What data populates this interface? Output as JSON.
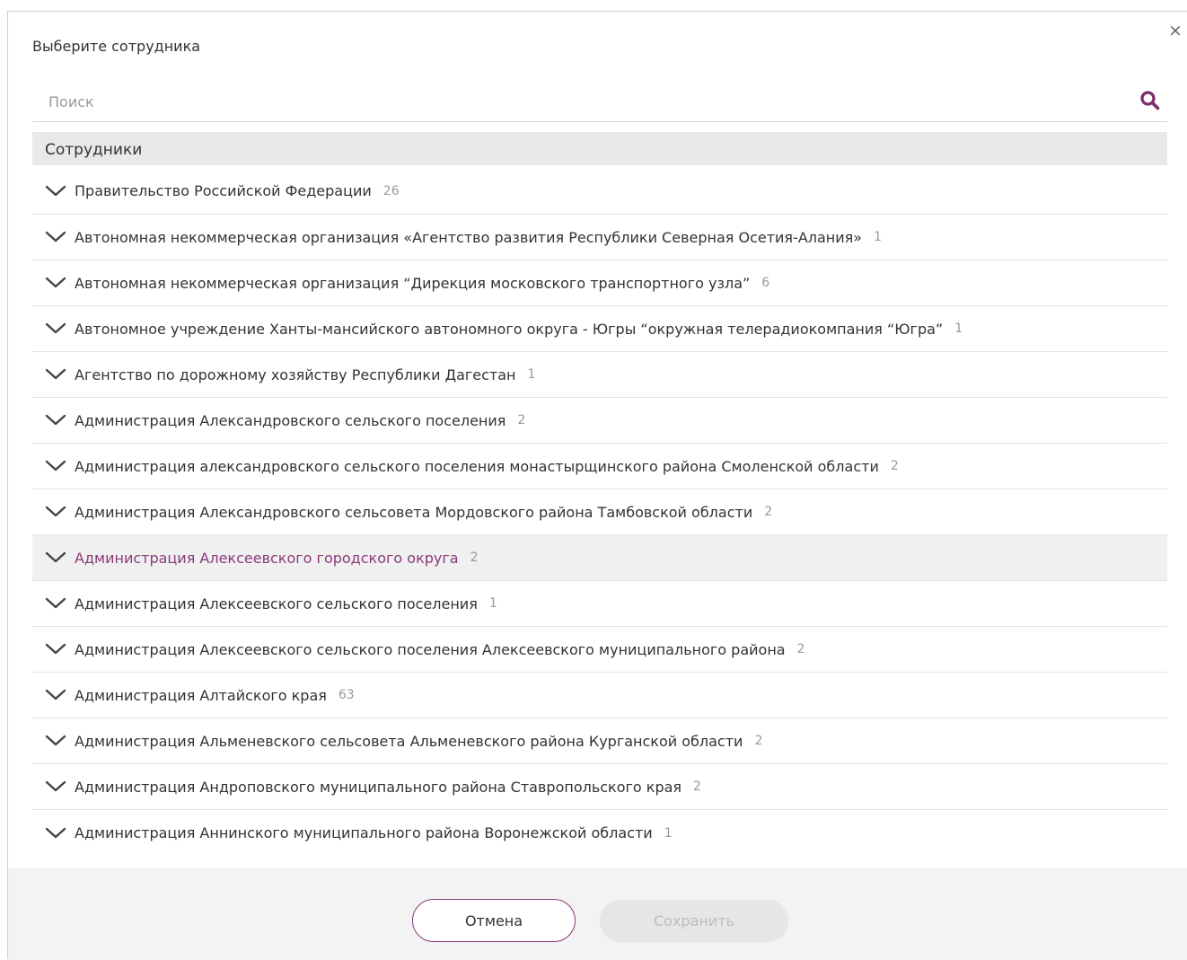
{
  "dialog": {
    "title": "Выберите сотрудника",
    "close_label": "×"
  },
  "search": {
    "placeholder": "Поиск",
    "value": ""
  },
  "section": {
    "header": "Сотрудники"
  },
  "items": [
    {
      "label": "Правительство Российской Федерации",
      "count": "26"
    },
    {
      "label": "Автономная некоммерческая организация «Агентство развития Республики Северная Осетия-Алания»",
      "count": "1"
    },
    {
      "label": "Автономная некоммерческая организация “Дирекция московского транспортного узла”",
      "count": "6"
    },
    {
      "label": "Автономное учреждение Ханты-мансийского автономного округа - Югры “окружная телерадиокомпания “Югра”",
      "count": "1"
    },
    {
      "label": "Агентство по дорожному хозяйству Республики Дагестан",
      "count": "1"
    },
    {
      "label": "Администрация Александровского сельского поселения",
      "count": "2"
    },
    {
      "label": "Администрация александровского сельского поселения монастырщинского района Смоленской области",
      "count": "2"
    },
    {
      "label": "Администрация Александровского сельсовета Мордовского района Тамбовской области",
      "count": "2"
    },
    {
      "label": "Администрация Алексеевского городского округа",
      "count": "2"
    },
    {
      "label": "Администрация Алексеевского сельского поселения",
      "count": "1"
    },
    {
      "label": "Администрация Алексеевского сельского поселения Алексеевского муниципального района",
      "count": "2"
    },
    {
      "label": "Администрация Алтайского края",
      "count": "63"
    },
    {
      "label": "Администрация Альменевского сельсовета Альменевского района Курганской области",
      "count": "2"
    },
    {
      "label": "Администрация Андроповского муниципального района Ставропольского края",
      "count": "2"
    },
    {
      "label": "Администрация Аннинского муниципального района Воронежской области",
      "count": "1"
    }
  ],
  "footer": {
    "cancel_label": "Отмена",
    "save_label": "Сохранить"
  },
  "colors": {
    "accent": "#8a3a78",
    "section_bg": "#e9e9e9",
    "highlight_bg": "#f0f0f0",
    "footer_bg": "#f3f3f3"
  },
  "icons": {
    "search": "search-icon",
    "expand": "chevron-down-icon",
    "close": "close-icon"
  }
}
